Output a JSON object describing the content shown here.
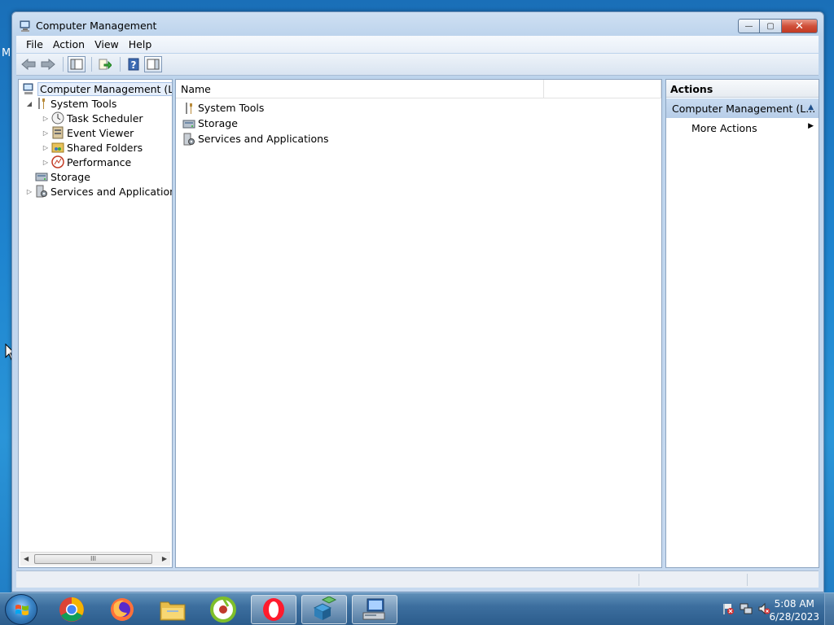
{
  "desktop": {
    "edge_letter": "M"
  },
  "window": {
    "title": "Computer Management",
    "controls": {
      "minimize": "—",
      "maximize": "▢",
      "close": "✕"
    }
  },
  "menu": [
    "File",
    "Action",
    "View",
    "Help"
  ],
  "toolbar": {
    "icons": [
      "back-icon",
      "forward-icon",
      "show-hide-tree-icon",
      "export-list-icon",
      "help-icon",
      "show-hide-action-pane-icon"
    ]
  },
  "tree": {
    "root": "Computer Management (Local",
    "items": [
      {
        "label": "System Tools",
        "level": 1,
        "expanded": true,
        "icon": "tools-icon"
      },
      {
        "label": "Task Scheduler",
        "level": 2,
        "icon": "clock-icon"
      },
      {
        "label": "Event Viewer",
        "level": 2,
        "icon": "event-viewer-icon"
      },
      {
        "label": "Shared Folders",
        "level": 2,
        "icon": "shared-folder-icon"
      },
      {
        "label": "Performance",
        "level": 2,
        "icon": "performance-icon"
      },
      {
        "label": "Storage",
        "level": 1,
        "icon": "storage-icon"
      },
      {
        "label": "Services and Applications",
        "level": 1,
        "icon": "services-icon"
      }
    ],
    "scroll_thumb": "III"
  },
  "list": {
    "column_name": "Name",
    "rows": [
      "System Tools",
      "Storage",
      "Services and Applications"
    ]
  },
  "actions": {
    "header": "Actions",
    "group": "Computer Management (L...",
    "items": [
      "More Actions"
    ]
  },
  "taskbar": {
    "apps": [
      "chrome-icon",
      "firefox-icon",
      "file-explorer-icon",
      "ccleaner-icon",
      "opera-icon",
      "registry-editor-icon",
      "computer-management-icon"
    ],
    "time": "5:08 AM",
    "date": "6/28/2023"
  }
}
